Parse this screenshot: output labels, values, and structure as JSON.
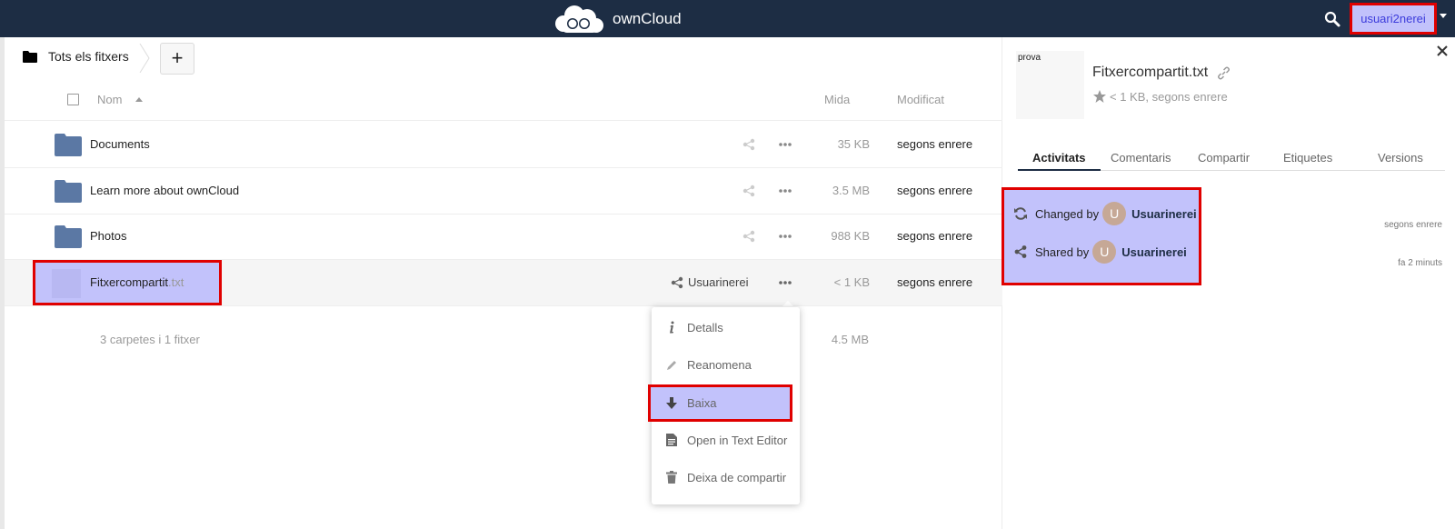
{
  "header": {
    "brand": "ownCloud",
    "user": "usuari2nerei"
  },
  "breadcrumb": {
    "home_label": "Tots els fitxers",
    "new_label": "+"
  },
  "table": {
    "col_name": "Nom",
    "col_size": "Mida",
    "col_modified": "Modificat",
    "rows": [
      {
        "name": "Documents",
        "size": "35 KB",
        "modified": "segons enrere"
      },
      {
        "name": "Learn more about ownCloud",
        "size": "3.5 MB",
        "modified": "segons enrere"
      },
      {
        "name": "Photos",
        "size": "988 KB",
        "modified": "segons enrere"
      }
    ],
    "file": {
      "name": "Fitxercompartit",
      "ext": ".txt",
      "shared_with": "Usuarinerei",
      "size": "< 1 KB",
      "modified": "segons enrere"
    },
    "summary": "3 carpetes i 1 fitxer",
    "summary_size": "4.5 MB"
  },
  "menu": {
    "items": [
      {
        "label": "Detalls"
      },
      {
        "label": "Reanomena"
      },
      {
        "label": "Baixa"
      },
      {
        "label": "Open in Text Editor"
      },
      {
        "label": "Deixa de compartir"
      }
    ]
  },
  "sidebar": {
    "thumb_text": "prova",
    "title": "Fitxercompartit.txt",
    "meta": "< 1 KB, segons enrere",
    "tabs": [
      "Activitats",
      "Comentaris",
      "Compartir",
      "Etiquetes",
      "Versions"
    ],
    "activities": [
      {
        "action": "Changed by",
        "avatar": "U",
        "who": "Usuarinerei",
        "time": "segons enrere"
      },
      {
        "action": "Shared by",
        "avatar": "U",
        "who": "Usuarinerei",
        "time": "fa 2 minuts"
      }
    ]
  }
}
